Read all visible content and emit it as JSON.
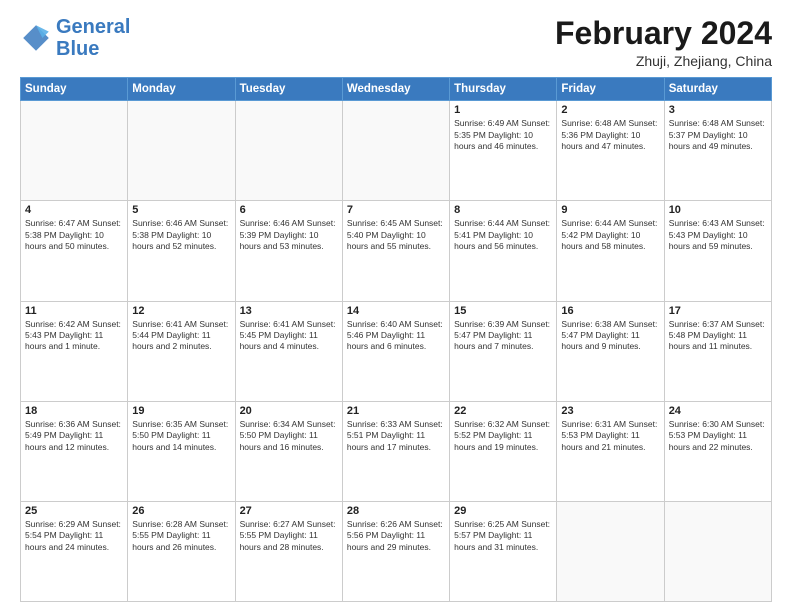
{
  "header": {
    "logo_general": "General",
    "logo_blue": "Blue",
    "month_year": "February 2024",
    "location": "Zhuji, Zhejiang, China"
  },
  "weekdays": [
    "Sunday",
    "Monday",
    "Tuesday",
    "Wednesday",
    "Thursday",
    "Friday",
    "Saturday"
  ],
  "weeks": [
    [
      {
        "day": "",
        "info": ""
      },
      {
        "day": "",
        "info": ""
      },
      {
        "day": "",
        "info": ""
      },
      {
        "day": "",
        "info": ""
      },
      {
        "day": "1",
        "info": "Sunrise: 6:49 AM\nSunset: 5:35 PM\nDaylight: 10 hours\nand 46 minutes."
      },
      {
        "day": "2",
        "info": "Sunrise: 6:48 AM\nSunset: 5:36 PM\nDaylight: 10 hours\nand 47 minutes."
      },
      {
        "day": "3",
        "info": "Sunrise: 6:48 AM\nSunset: 5:37 PM\nDaylight: 10 hours\nand 49 minutes."
      }
    ],
    [
      {
        "day": "4",
        "info": "Sunrise: 6:47 AM\nSunset: 5:38 PM\nDaylight: 10 hours\nand 50 minutes."
      },
      {
        "day": "5",
        "info": "Sunrise: 6:46 AM\nSunset: 5:38 PM\nDaylight: 10 hours\nand 52 minutes."
      },
      {
        "day": "6",
        "info": "Sunrise: 6:46 AM\nSunset: 5:39 PM\nDaylight: 10 hours\nand 53 minutes."
      },
      {
        "day": "7",
        "info": "Sunrise: 6:45 AM\nSunset: 5:40 PM\nDaylight: 10 hours\nand 55 minutes."
      },
      {
        "day": "8",
        "info": "Sunrise: 6:44 AM\nSunset: 5:41 PM\nDaylight: 10 hours\nand 56 minutes."
      },
      {
        "day": "9",
        "info": "Sunrise: 6:44 AM\nSunset: 5:42 PM\nDaylight: 10 hours\nand 58 minutes."
      },
      {
        "day": "10",
        "info": "Sunrise: 6:43 AM\nSunset: 5:43 PM\nDaylight: 10 hours\nand 59 minutes."
      }
    ],
    [
      {
        "day": "11",
        "info": "Sunrise: 6:42 AM\nSunset: 5:43 PM\nDaylight: 11 hours\nand 1 minute."
      },
      {
        "day": "12",
        "info": "Sunrise: 6:41 AM\nSunset: 5:44 PM\nDaylight: 11 hours\nand 2 minutes."
      },
      {
        "day": "13",
        "info": "Sunrise: 6:41 AM\nSunset: 5:45 PM\nDaylight: 11 hours\nand 4 minutes."
      },
      {
        "day": "14",
        "info": "Sunrise: 6:40 AM\nSunset: 5:46 PM\nDaylight: 11 hours\nand 6 minutes."
      },
      {
        "day": "15",
        "info": "Sunrise: 6:39 AM\nSunset: 5:47 PM\nDaylight: 11 hours\nand 7 minutes."
      },
      {
        "day": "16",
        "info": "Sunrise: 6:38 AM\nSunset: 5:47 PM\nDaylight: 11 hours\nand 9 minutes."
      },
      {
        "day": "17",
        "info": "Sunrise: 6:37 AM\nSunset: 5:48 PM\nDaylight: 11 hours\nand 11 minutes."
      }
    ],
    [
      {
        "day": "18",
        "info": "Sunrise: 6:36 AM\nSunset: 5:49 PM\nDaylight: 11 hours\nand 12 minutes."
      },
      {
        "day": "19",
        "info": "Sunrise: 6:35 AM\nSunset: 5:50 PM\nDaylight: 11 hours\nand 14 minutes."
      },
      {
        "day": "20",
        "info": "Sunrise: 6:34 AM\nSunset: 5:50 PM\nDaylight: 11 hours\nand 16 minutes."
      },
      {
        "day": "21",
        "info": "Sunrise: 6:33 AM\nSunset: 5:51 PM\nDaylight: 11 hours\nand 17 minutes."
      },
      {
        "day": "22",
        "info": "Sunrise: 6:32 AM\nSunset: 5:52 PM\nDaylight: 11 hours\nand 19 minutes."
      },
      {
        "day": "23",
        "info": "Sunrise: 6:31 AM\nSunset: 5:53 PM\nDaylight: 11 hours\nand 21 minutes."
      },
      {
        "day": "24",
        "info": "Sunrise: 6:30 AM\nSunset: 5:53 PM\nDaylight: 11 hours\nand 22 minutes."
      }
    ],
    [
      {
        "day": "25",
        "info": "Sunrise: 6:29 AM\nSunset: 5:54 PM\nDaylight: 11 hours\nand 24 minutes."
      },
      {
        "day": "26",
        "info": "Sunrise: 6:28 AM\nSunset: 5:55 PM\nDaylight: 11 hours\nand 26 minutes."
      },
      {
        "day": "27",
        "info": "Sunrise: 6:27 AM\nSunset: 5:55 PM\nDaylight: 11 hours\nand 28 minutes."
      },
      {
        "day": "28",
        "info": "Sunrise: 6:26 AM\nSunset: 5:56 PM\nDaylight: 11 hours\nand 29 minutes."
      },
      {
        "day": "29",
        "info": "Sunrise: 6:25 AM\nSunset: 5:57 PM\nDaylight: 11 hours\nand 31 minutes."
      },
      {
        "day": "",
        "info": ""
      },
      {
        "day": "",
        "info": ""
      }
    ]
  ]
}
